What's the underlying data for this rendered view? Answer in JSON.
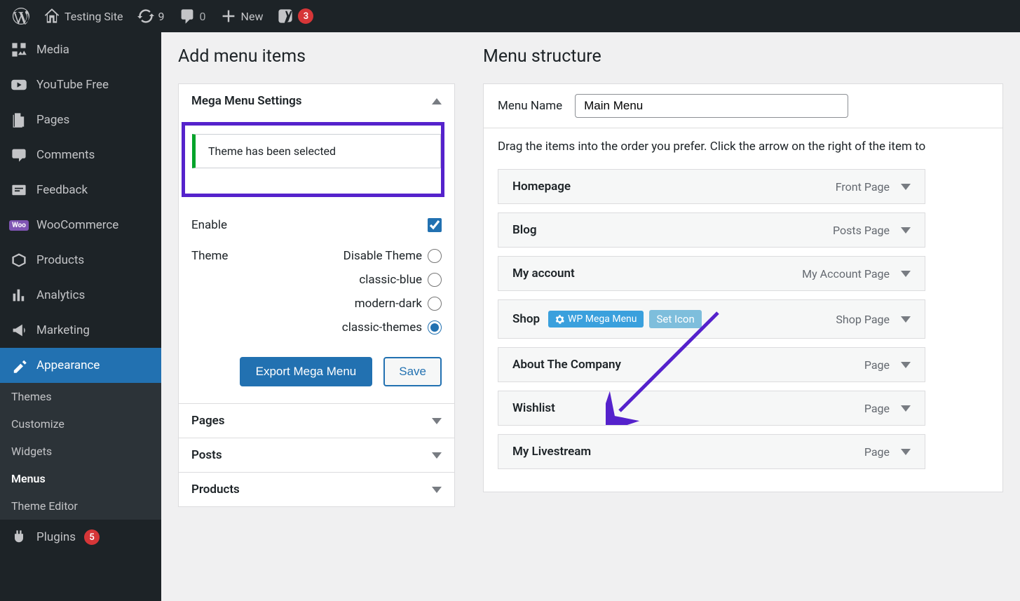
{
  "adminbar": {
    "site_name": "Testing Site",
    "updates_count": "9",
    "comments_count": "0",
    "new_label": "New",
    "yoast_count": "3"
  },
  "sidebar": {
    "items": [
      {
        "label": "Media",
        "icon": "media"
      },
      {
        "label": "YouTube Free",
        "icon": "youtube"
      },
      {
        "label": "Pages",
        "icon": "pages"
      },
      {
        "label": "Comments",
        "icon": "comment"
      },
      {
        "label": "Feedback",
        "icon": "feedback"
      },
      {
        "label": "WooCommerce",
        "icon": "woo"
      },
      {
        "label": "Products",
        "icon": "products"
      },
      {
        "label": "Analytics",
        "icon": "analytics"
      },
      {
        "label": "Marketing",
        "icon": "marketing"
      },
      {
        "label": "Appearance",
        "icon": "appearance",
        "current": true
      },
      {
        "label": "Plugins",
        "icon": "plugins",
        "count": "5"
      }
    ],
    "submenu": [
      {
        "label": "Themes"
      },
      {
        "label": "Customize"
      },
      {
        "label": "Widgets"
      },
      {
        "label": "Menus",
        "current": true
      },
      {
        "label": "Theme Editor"
      }
    ]
  },
  "left_panel": {
    "title": "Add menu items",
    "mega_menu": {
      "header": "Mega Menu Settings",
      "notice": "Theme has been selected",
      "enable_label": "Enable",
      "theme_label": "Theme",
      "theme_options": [
        "Disable Theme",
        "classic-blue",
        "modern-dark",
        "classic-themes"
      ],
      "selected_theme": "classic-themes",
      "export_btn": "Export Mega Menu",
      "save_btn": "Save"
    },
    "accordions": [
      {
        "label": "Pages"
      },
      {
        "label": "Posts"
      },
      {
        "label": "Products"
      }
    ]
  },
  "right_panel": {
    "title": "Menu structure",
    "name_label": "Menu Name",
    "name_value": "Main Menu",
    "instructions": "Drag the items into the order you prefer. Click the arrow on the right of the item to",
    "items": [
      {
        "title": "Homepage",
        "type": "Front Page"
      },
      {
        "title": "Blog",
        "type": "Posts Page"
      },
      {
        "title": "My account",
        "type": "My Account Page"
      },
      {
        "title": "Shop",
        "type": "Shop Page",
        "mega_badges": true,
        "wp_mega_label": "WP Mega Menu",
        "set_icon_label": "Set Icon"
      },
      {
        "title": "About The Company",
        "type": "Page"
      },
      {
        "title": "Wishlist",
        "type": "Page"
      },
      {
        "title": "My Livestream",
        "type": "Page"
      }
    ]
  }
}
